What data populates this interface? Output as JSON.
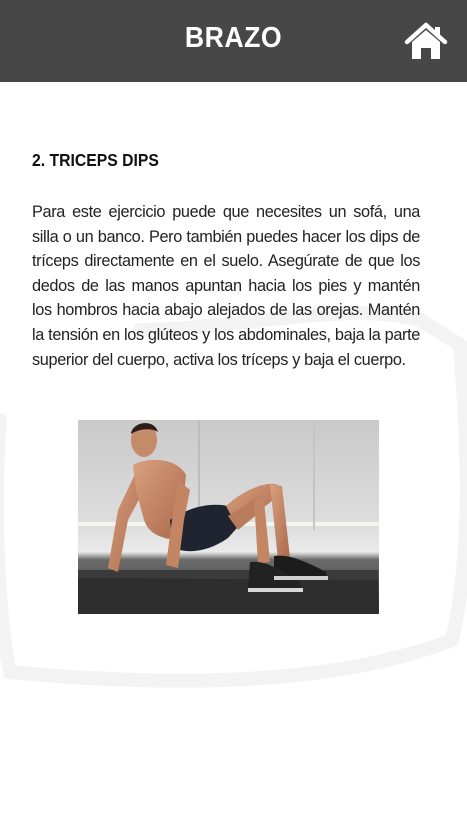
{
  "header": {
    "title": "BRAZO",
    "home_icon": "home-icon",
    "background_color": "#474747"
  },
  "exercise": {
    "title": "2. TRICEPS DIPS",
    "description": "Para este ejercicio puede que necesites un sofá, una silla o un banco. Pero también puedes hacer los dips de tríceps directamente en el suelo. Asegúrate de que los dedos de las manos apuntan hacia los pies y mantén los hombros hacia abajo alejados de las orejas. Mantén la tensión en los glúteos y los abdominales, baja la parte superior del cuerpo, activa los tríceps y baja el cuerpo.",
    "image": "man-doing-triceps-dips-on-floor-mat"
  }
}
